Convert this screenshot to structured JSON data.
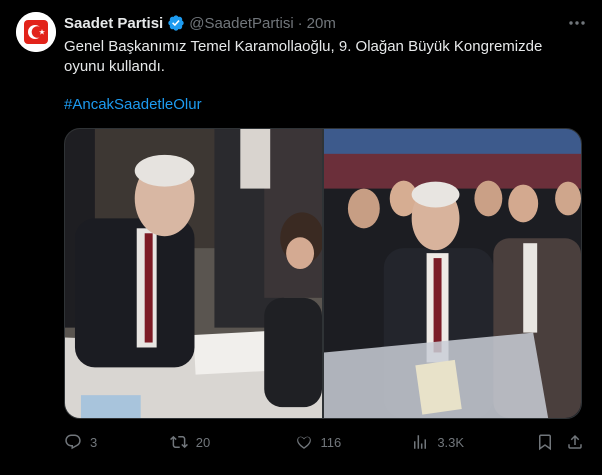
{
  "tweet": {
    "author_name": "Saadet Partisi",
    "handle": "@SaadetPartisi",
    "separator": "·",
    "time": "20m",
    "text": "Genel Başkanımız Temel Karamollaoğlu, 9. Olağan Büyük Kongremizde oyunu kullandı.",
    "hashtag": "#AncakSaadetleOlur"
  },
  "media": {
    "photos": [
      {
        "name": "photo-signing"
      },
      {
        "name": "photo-ballot-box"
      }
    ]
  },
  "actions": {
    "replies": "3",
    "retweets": "20",
    "likes": "116",
    "views": "3.3K"
  },
  "colors": {
    "background": "#000000",
    "text": "#e7e9ea",
    "muted": "#71767b",
    "link": "#1d9bf0",
    "party_red": "#e2231a"
  }
}
